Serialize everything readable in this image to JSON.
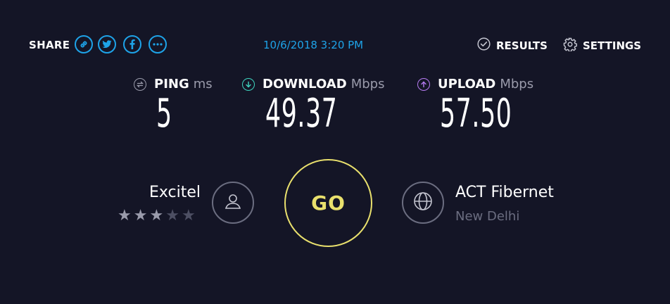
{
  "header": {
    "share_label": "SHARE",
    "share_icons": [
      "link-icon",
      "twitter-icon",
      "facebook-icon",
      "more-icon"
    ],
    "timestamp": "10/6/2018 3:20 PM",
    "results_label": "RESULTS",
    "settings_label": "SETTINGS"
  },
  "metrics": {
    "ping": {
      "label": "PING",
      "unit": "ms",
      "value": "5",
      "color": "#9a9bab"
    },
    "download": {
      "label": "DOWNLOAD",
      "unit": "Mbps",
      "value": "49.37",
      "color": "#3fd6c0"
    },
    "upload": {
      "label": "UPLOAD",
      "unit": "Mbps",
      "value": "57.50",
      "color": "#b77cf2"
    }
  },
  "isp": {
    "name": "Excitel",
    "rating": 3,
    "rating_max": 5,
    "star_filled_color": "#9a9bab",
    "star_empty_color": "#4d4f63"
  },
  "go": {
    "label": "GO",
    "color": "#e9e06d"
  },
  "server": {
    "name": "ACT Fibernet",
    "location": "New Delhi"
  },
  "colors": {
    "background": "#141526",
    "accent": "#1ea3e8"
  }
}
